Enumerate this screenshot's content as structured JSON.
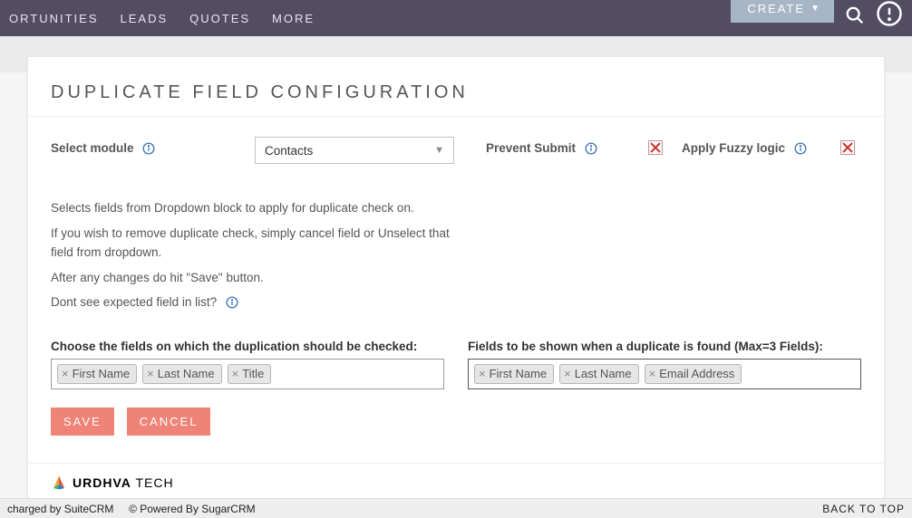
{
  "topnav": {
    "items": [
      "ORTUNITIES",
      "LEADS",
      "QUOTES",
      "MORE"
    ],
    "create": "CREATE"
  },
  "page": {
    "title": "DUPLICATE FIELD CONFIGURATION"
  },
  "moduleSelect": {
    "label": "Select module",
    "value": "Contacts"
  },
  "preventSubmit": {
    "label": "Prevent Submit"
  },
  "applyFuzzy": {
    "label": "Apply Fuzzy logic"
  },
  "help": {
    "line1": "Selects fields from Dropdown block to apply for duplicate check on.",
    "line2": "If you wish to remove duplicate check, simply cancel field or Unselect that field from dropdown.",
    "line3": "After any changes do hit \"Save\" button.",
    "line4": "Dont see expected field in list?"
  },
  "dupFields": {
    "label": "Choose the fields on which the duplication should be checked:",
    "tags": [
      "First Name",
      "Last Name",
      "Title"
    ]
  },
  "showFields": {
    "label": "Fields to be shown when a duplicate is found (Max=3 Fields):",
    "tags": [
      "First Name",
      "Last Name",
      "Email Address"
    ]
  },
  "buttons": {
    "save": "SAVE",
    "cancel": "CANCEL"
  },
  "footer": {
    "brand1": "URDHVA",
    "brand2": " TECH"
  },
  "bottom": {
    "left1": "charged by SuiteCRM",
    "left2": "© Powered By SugarCRM",
    "right": "BACK TO TOP"
  }
}
